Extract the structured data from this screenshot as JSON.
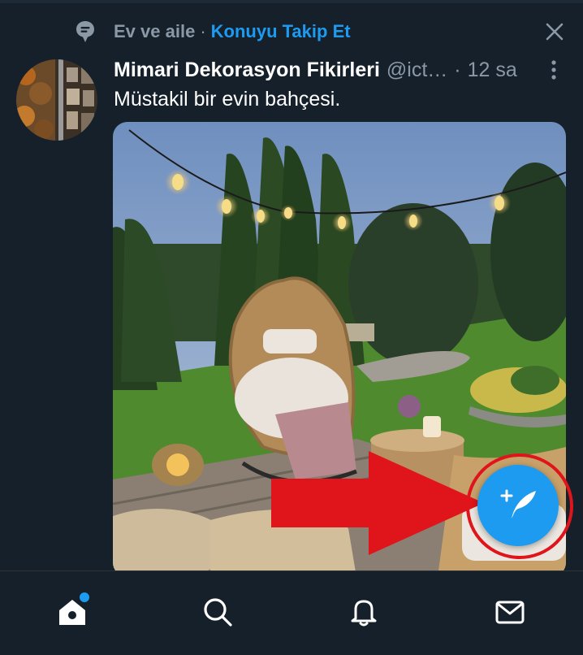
{
  "context": {
    "icon": "topic-bubble-icon",
    "topic": "Ev ve aile",
    "separator": "·",
    "follow_label": "Konuyu Takip Et"
  },
  "tweet": {
    "author_name": "Mimari Dekorasyon Fikirleri",
    "handle": "@ict…",
    "separator": "·",
    "time": "12 sa",
    "text": "Müstakil bir evin bahçesi.",
    "media_alt": "garden photo"
  },
  "compose_button": {
    "icon": "compose-tweet-icon"
  },
  "annotation": {
    "color": "#e0141b"
  },
  "bottom_nav": [
    {
      "name": "home",
      "icon": "home-icon",
      "has_badge": true
    },
    {
      "name": "search",
      "icon": "search-icon"
    },
    {
      "name": "notifications",
      "icon": "bell-icon"
    },
    {
      "name": "messages",
      "icon": "mail-icon"
    }
  ],
  "colors": {
    "background": "#15202b",
    "accent": "#1d9bf0",
    "muted": "#8b98a5"
  }
}
